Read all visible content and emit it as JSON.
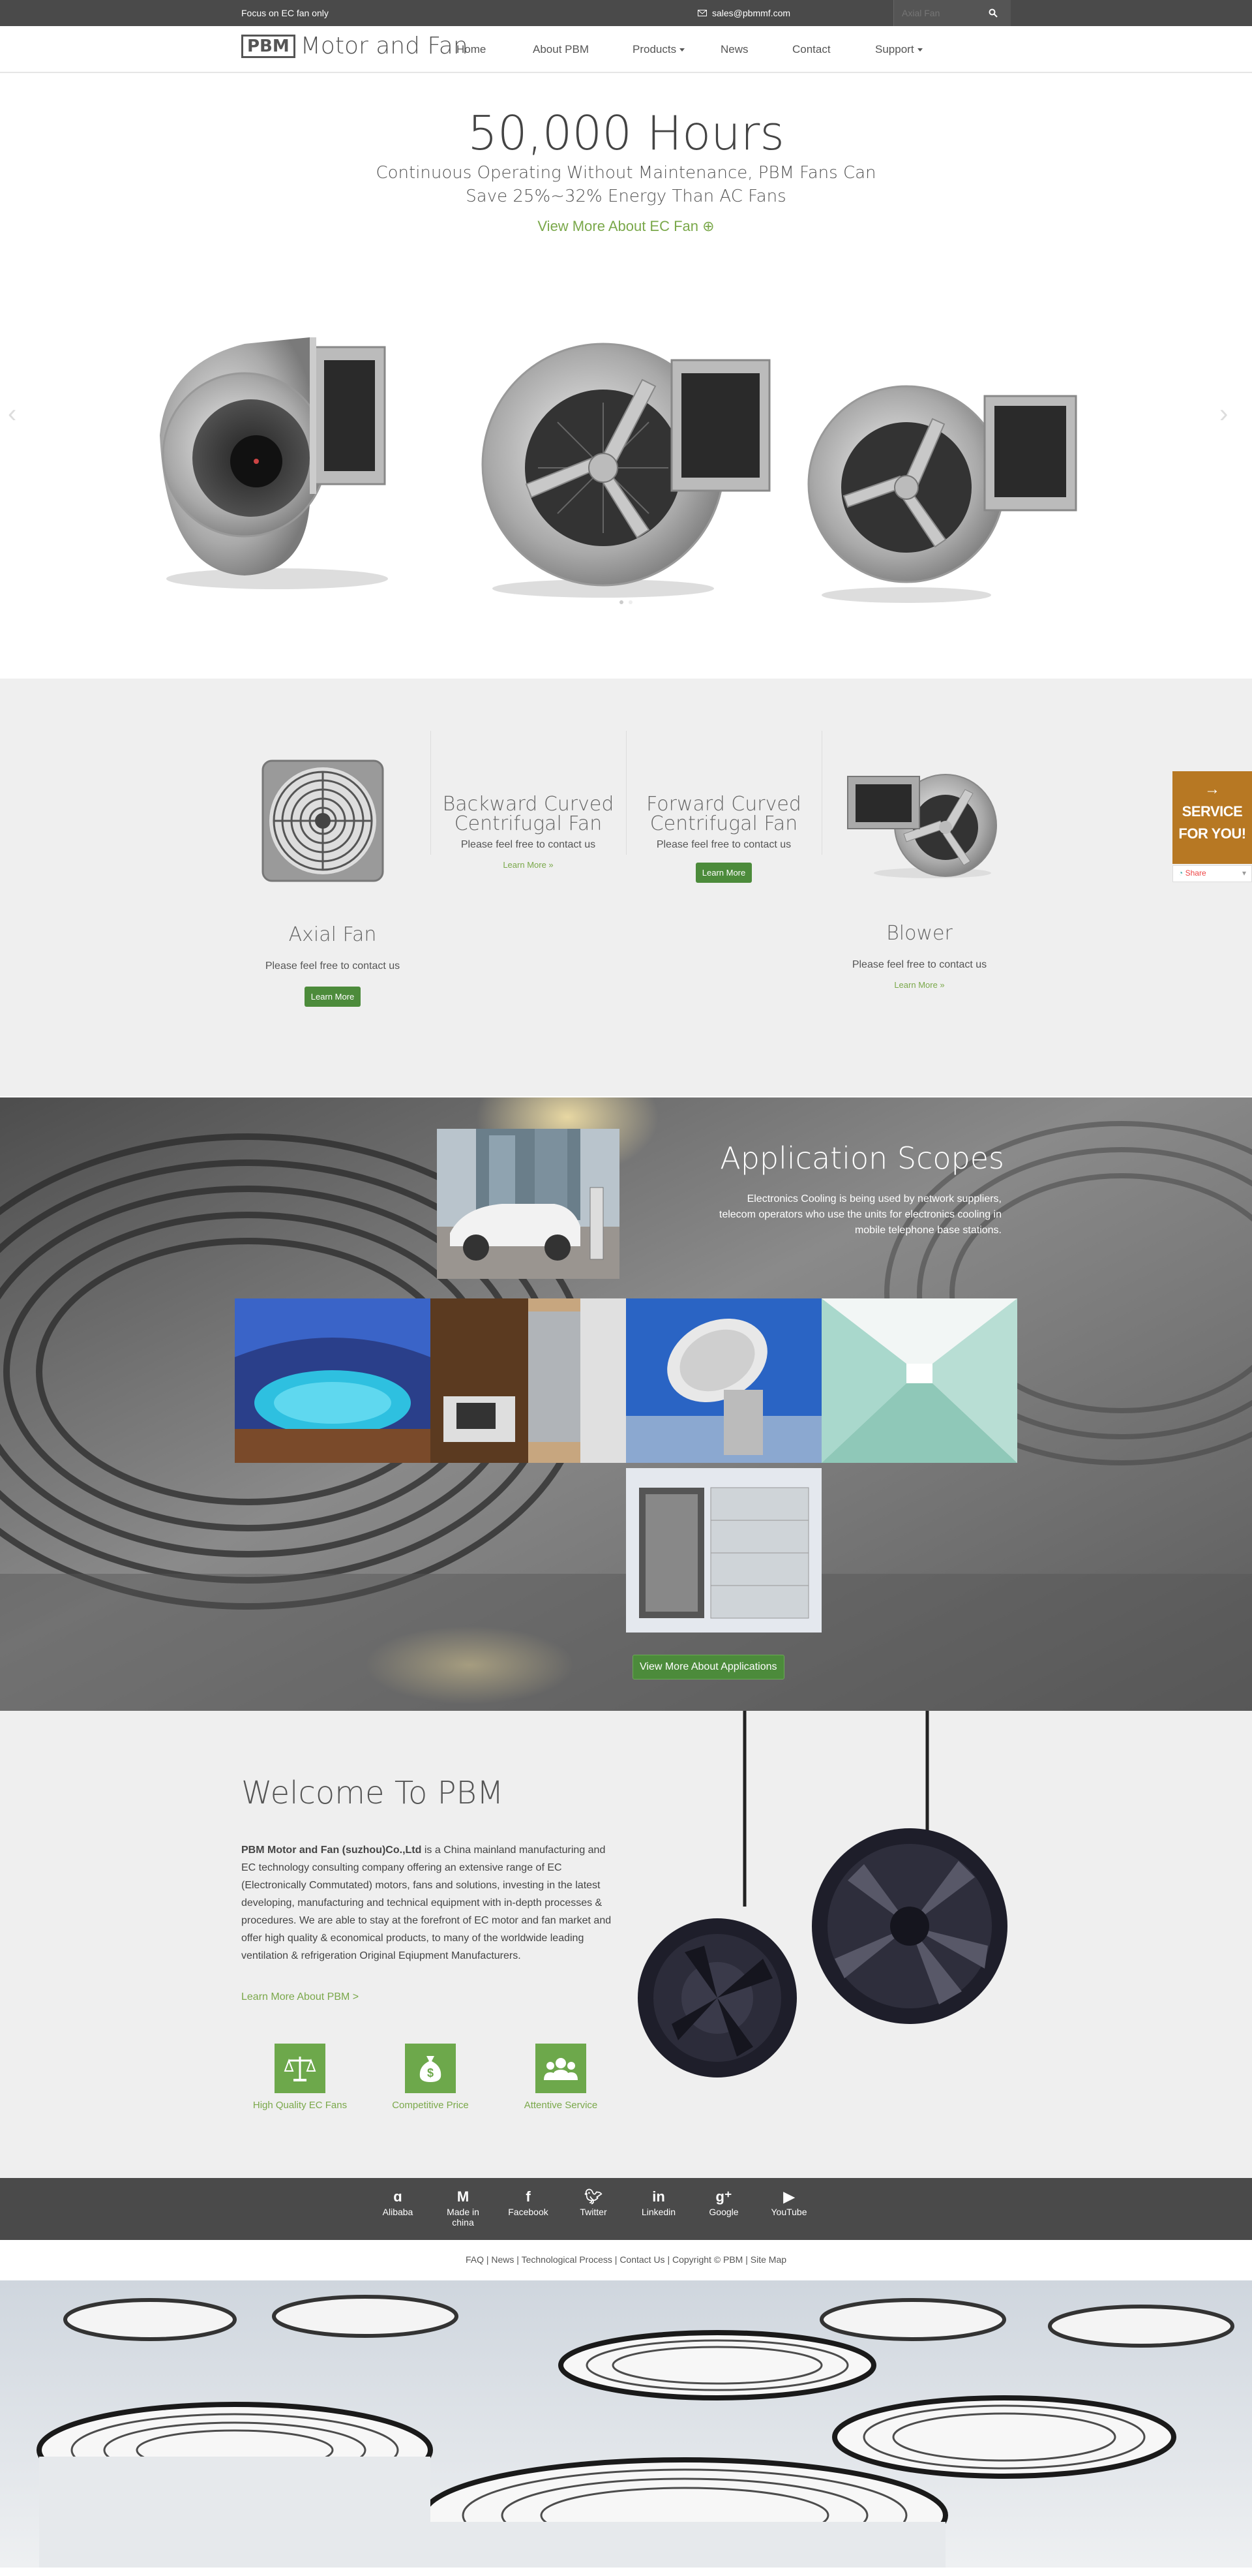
{
  "topbar": {
    "tagline": "Focus on EC fan only",
    "email": "sales@pbmmf.com",
    "search_placeholder": "Axial Fan"
  },
  "header": {
    "logo_mark": "PBM",
    "logo_word": "Motor and Fan",
    "nav": [
      "Home",
      "About PBM",
      "Products",
      "News",
      "Contact",
      "Support"
    ]
  },
  "hero": {
    "title": "50,000 Hours",
    "subtitle_line1": "Continuous Operating Without Maintenance, PBM Fans Can",
    "subtitle_line2": "Save 25%~32% Energy Than AC Fans",
    "link": "View More About EC Fan"
  },
  "products": {
    "axial": {
      "title": "Axial Fan",
      "text": "Please feel free to contact us",
      "button": "Learn More"
    },
    "backward": {
      "title_line1": "Backward Curved",
      "title_line2": "Centrifugal Fan",
      "text": "Please feel free to contact us",
      "link": "Learn More »"
    },
    "forward": {
      "title_line1": "Forward Curved",
      "title_line2": "Centrifugal Fan",
      "text": "Please feel free to contact us",
      "button": "Learn More"
    },
    "blower": {
      "title": "Blower",
      "text": "Please feel free to contact us",
      "link": "Learn More »"
    }
  },
  "service": {
    "line1": "SERVICE",
    "line2": "FOR YOU!",
    "share": "Share"
  },
  "applications": {
    "title": "Application Scopes",
    "desc": "Electronics Cooling is being used by network suppliers, telecom operators who use the units for electronics cooling in mobile telephone base stations.",
    "button": "View More About Applications"
  },
  "welcome": {
    "title": "Welcome To PBM",
    "company": "PBM Motor and Fan (suzhou)Co.,Ltd",
    "body": " is a China mainland manufacturing and  EC technology consulting company offering an extensive range of EC  (Electronically Commutated) motors, fans and solutions, investing in the latest developing, manufacturing and technical equipment with in-depth processes & procedures. We are able to stay at the forefront of EC motor and fan market and offer high quality & economical products, to many of the worldwide leading ventilation & refrigeration Original Eqiupment Manufacturers.",
    "link": "Learn More About PBM >",
    "features": [
      "High Quality EC Fans",
      "Competitive Price",
      "Attentive Service"
    ]
  },
  "social": [
    {
      "label": "Alibaba",
      "icon": "alibaba-icon"
    },
    {
      "label": "Made in china",
      "icon": "made-in-china-icon"
    },
    {
      "label": "Facebook",
      "icon": "facebook-icon"
    },
    {
      "label": "Twitter",
      "icon": "twitter-icon"
    },
    {
      "label": "Linkedin",
      "icon": "linkedin-icon"
    },
    {
      "label": "Google",
      "icon": "google-plus-icon"
    },
    {
      "label": "YouTube",
      "icon": "youtube-icon"
    }
  ],
  "footer_links": [
    "FAQ",
    "News",
    "Technological Process",
    "Contact Us",
    "Copyright © PBM",
    "Site Map"
  ],
  "colors": {
    "accent_green": "#4c8b3b",
    "link_green": "#7aa84a",
    "service_orange": "#b77823",
    "dark_bar": "#4a4a4a"
  }
}
